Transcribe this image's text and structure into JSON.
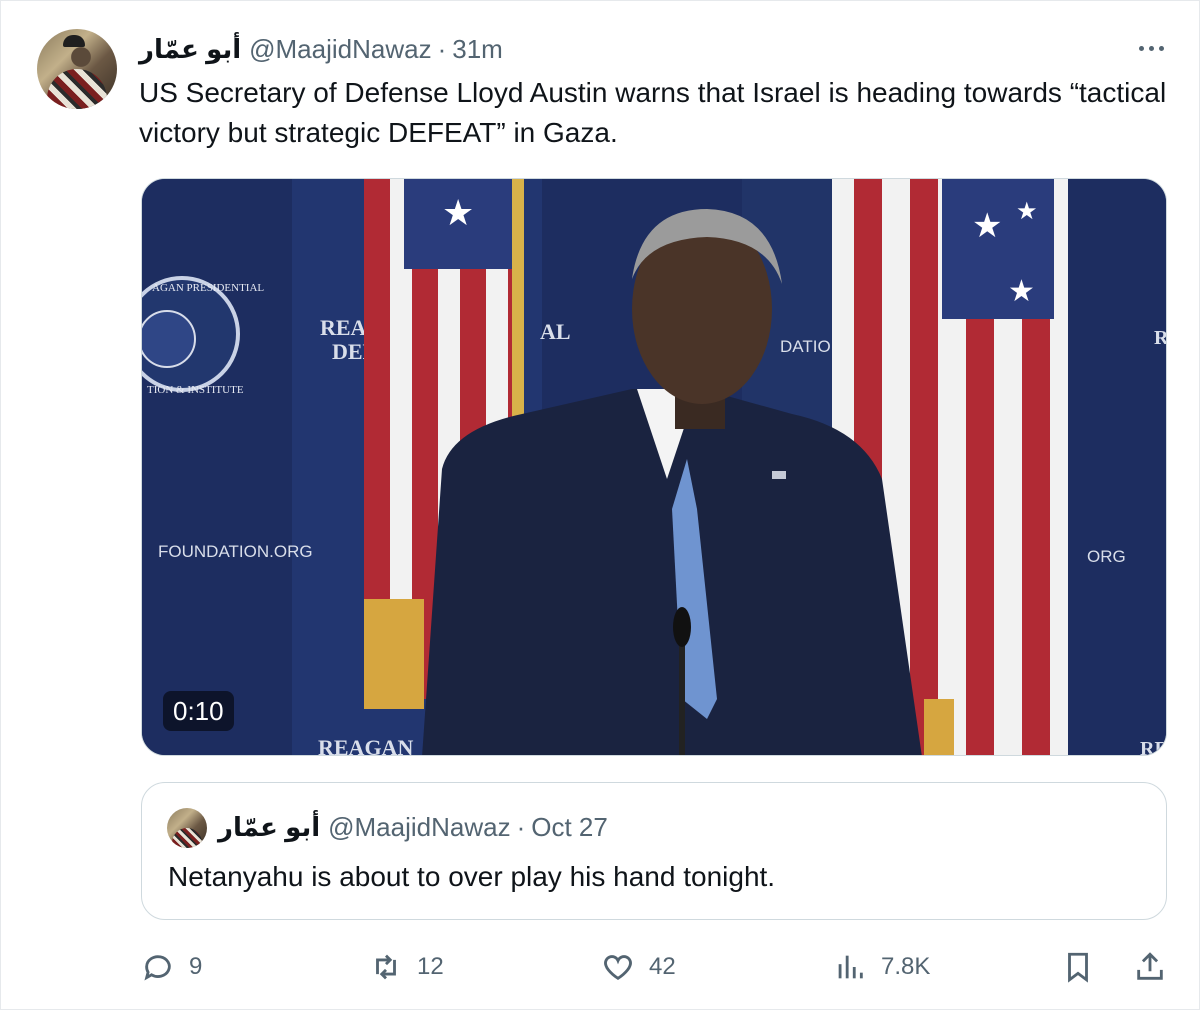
{
  "tweet": {
    "display_name": "أبو عمّار",
    "handle": "@MaajidNawaz",
    "separator": "·",
    "time": "31m",
    "text": "US Secretary of Defense Lloyd Austin warns that Israel is heading towards “tactical victory but strategic DEFEAT” in Gaza."
  },
  "media": {
    "duration": "0:10",
    "backdrop_texts": [
      "REAG",
      "DEF",
      "AL",
      "DATION.O",
      "FOUNDATION.ORG",
      "ORG",
      "REAGAN",
      "R",
      "RE"
    ],
    "seal_text_top": "AGAN PRESIDENTIAL",
    "seal_text_bottom": "TION & INSTITUTE"
  },
  "quote": {
    "display_name": "أبو عمّار",
    "handle": "@MaajidNawaz",
    "separator": "·",
    "date": "Oct 27",
    "text": "Netanyahu is about to over play his hand tonight."
  },
  "actions": {
    "replies": "9",
    "reposts": "12",
    "likes": "42",
    "views": "7.8K"
  },
  "icons": {
    "more": "more-icon",
    "reply": "reply-icon",
    "repost": "repost-icon",
    "like": "heart-icon",
    "views": "views-icon",
    "bookmark": "bookmark-icon",
    "share": "share-icon"
  },
  "colors": {
    "text": "#0f1419",
    "secondary": "#536471",
    "border": "#cfd9de",
    "backdrop": "#1b2a5a"
  }
}
